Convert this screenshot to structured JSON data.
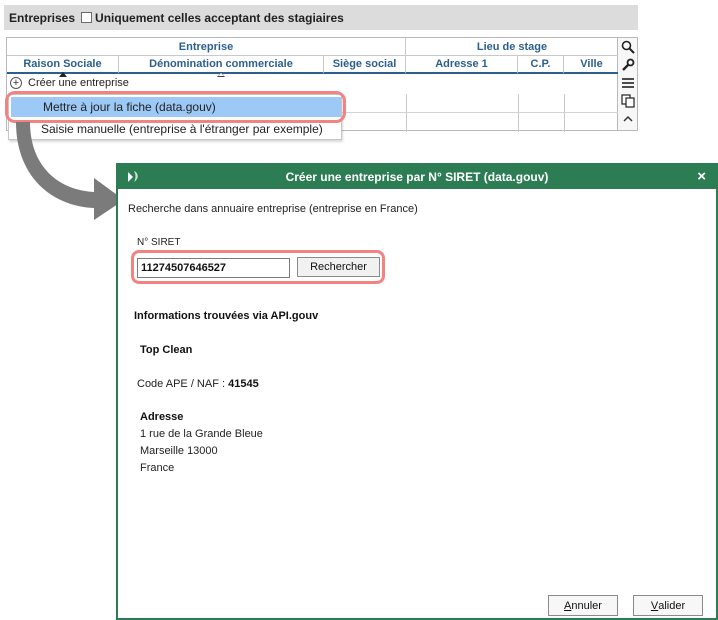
{
  "topbar": {
    "title": "Entreprises",
    "filter_label": "Uniquement celles acceptant des stagiaires"
  },
  "grid": {
    "groups": [
      "Entreprise",
      "Lieu de stage"
    ],
    "columns": [
      "Raison Sociale",
      "Dénomination commerciale",
      "Siège social",
      "Adresse 1",
      "C.P.",
      "Ville"
    ],
    "create_label": "Créer une entreprise"
  },
  "context_menu": {
    "items": [
      "Mettre à jour la fiche (data.gouv)",
      "Saisie manuelle (entreprise à l'étranger par exemple)"
    ]
  },
  "dialog": {
    "title": "Créer une entreprise par N° SIRET (data.gouv)",
    "close": "×",
    "subtitle": "Recherche dans annuaire entreprise (entreprise en France)",
    "siret_label": "N° SIRET",
    "siret_value": "11274507646527",
    "search_button": "Rechercher",
    "info_title": "Informations trouvées via API.gouv",
    "company_name": "Top Clean",
    "ape_label": "Code APE / NAF :",
    "ape_value": "41545",
    "address_title": "Adresse",
    "address_lines": [
      "1 rue de la Grande Bleue",
      "Marseille 13000",
      "France"
    ],
    "cancel_button": "Annuler",
    "cancel_mnemonic": "A",
    "cancel_rest": "nnuler",
    "ok_button": "Valider",
    "ok_mnemonic": "V",
    "ok_rest": "alider"
  },
  "colors": {
    "dialog_green": "#2d7d54",
    "header_blue": "#2c5f8e",
    "highlight": "#f18481",
    "menu_selection": "#9cc9f5"
  }
}
